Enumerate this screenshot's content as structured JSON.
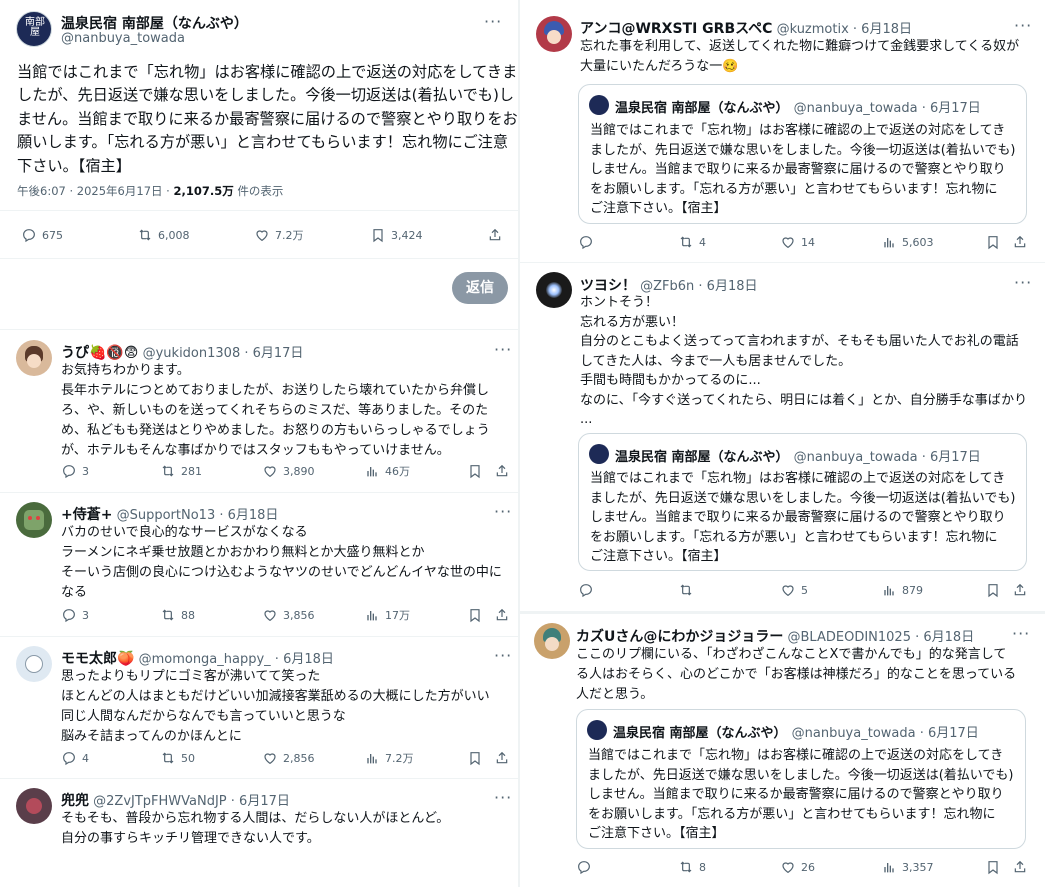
{
  "main_tweet": {
    "name": "温泉民宿 南部屋（なんぶや）",
    "handle": "@nanbuya_towada",
    "lines": [
      "当館ではこれまで「忘れ物」はお客様に確認の上で返送の対応をしてきま",
      "したが、先日返送で嫌な思いをしました。今後一切返送は(着払いでも)し",
      "ません。当館まで取りに来るか最寄警察に届けるので警察とやり取りをお",
      "願いします。「忘れる方が悪い」と言わせてもらいます！忘れ物にご注意",
      "下さい。【宿主】"
    ],
    "meta_time": "午後6:07 · 2025年6月17日 · ",
    "meta_views": "2,107.5万",
    "meta_suffix": " 件の表示",
    "replies": "675",
    "reposts": "6,008",
    "likes": "7.2万",
    "bookmarks": "3,424",
    "reply_button": "返信"
  },
  "quote_text_lines": [
    "当館ではこれまで「忘れ物」はお客様に確認の上で返送の対応をしてき",
    "ましたが、先日返送で嫌な思いをしました。今後一切返送は(着払いでも)",
    "しません。当館まで取りに来るか最寄警察に届けるので警察とやり取り",
    "をお願いします。「忘れる方が悪い」と言わせてもらいます！忘れ物に",
    "ご注意下さい。【宿主】"
  ],
  "quote_name": "温泉民宿 南部屋（なんぶや）",
  "quote_handle_date": "@nanbuya_towada · 6月17日",
  "left_replies": [
    {
      "name": "うぴ🍓🔞😨",
      "meta": "@yukidon1308 · 6月17日",
      "lines": [
        "お気持ちわかります。",
        "長年ホテルにつとめておりましたが、お送りしたら壊れていたから弁償し",
        "ろ、や、新しいものを送ってくれそちらのミスだ、等ありました。そのた",
        "め、私どもも発送はとりやめました。お怒りの方もいらっしゃるでしょう",
        "が、ホテルもそんな事ばかりではスタッフももやっていけません。"
      ],
      "replies": "3",
      "reposts": "281",
      "likes": "3,890",
      "views": "46万",
      "avatar_color": "#d9b99b"
    },
    {
      "name": "+侍蒼+",
      "meta": "@SupportNo13 · 6月18日",
      "lines": [
        "バカのせいで良心的なサービスがなくなる",
        "ラーメンにネギ乗せ放題とかおかわり無料とか大盛り無料とか",
        "そーいう店側の良心につけ込むようなヤツのせいでどんどんイヤな世の中に",
        "なる"
      ],
      "replies": "3",
      "reposts": "88",
      "likes": "3,856",
      "views": "17万",
      "avatar_color": "#4a6b3d"
    },
    {
      "name": "モモ太郎🍑",
      "meta": "@momonga_happy_ · 6月18日",
      "lines": [
        "思ったよりもリプにゴミ客が沸いてて笑った",
        "ほとんどの人はまともだけどいい加減接客業舐めるの大概にした方がいい",
        "同じ人間なんだからなんでも言っていいと思うな",
        "脳みそ詰まってんのかほんとに"
      ],
      "replies": "4",
      "reposts": "50",
      "likes": "2,856",
      "views": "7.2万",
      "avatar_color": "#dfe9f2"
    },
    {
      "name": "兜兜",
      "meta": "@2ZvJTpFHWVaNdJP · 6月17日",
      "lines": [
        "そもそも、普段から忘れ物する人間は、だらしない人がほとんど。",
        "自分の事すらキッチリ管理できない人です。"
      ],
      "avatar_color": "#5a3e4a"
    }
  ],
  "right_replies": [
    {
      "name": "アンコ@WRXSTI GRBスペC",
      "meta": "@kuzmotix · 6月18日",
      "lines": [
        "忘れた事を利用して、返送してくれた物に難癖つけて金銭要求してくる奴が",
        "大量にいたんだろうな一🥴"
      ],
      "replies": "",
      "reposts": "4",
      "likes": "14",
      "views": "5,603",
      "avatar_color": "#b23a48"
    },
    {
      "name": "ツヨシ！",
      "meta": "@ZFb6n · 6月18日",
      "lines": [
        "ホントそう！",
        "忘れる方が悪い！",
        "自分のとこもよく送ってって言われますが、そもそも届いた人でお礼の電話",
        "してきた人は、今まで一人も居ませんでした。",
        "手間も時間もかかってるのに...",
        "なのに、「今すぐ送ってくれたら、明日には着く」とか、自分勝手な事ばかり",
        "..."
      ],
      "replies": "",
      "reposts": "",
      "likes": "5",
      "views": "879",
      "avatar_color": "#1a1a1a"
    },
    {
      "name": "カズUさん@にわかジョジョラー",
      "meta": "@BLADEODIN1025 · 6月18日",
      "lines": [
        "ここのリプ欄にいる、「わざわざこんなことXで書かんでも」的な発言して",
        "る人はおそらく、心のどこかで「お客様は神様だろ」的なことを思っている",
        "人だと思う。"
      ],
      "replies": "",
      "reposts": "8",
      "likes": "26",
      "views": "3,357",
      "avatar_color": "#c9a16b"
    }
  ],
  "colors": {
    "text": "#0f1419",
    "muted": "#536471",
    "border": "#cfd9de",
    "button": "#8b98a5"
  },
  "icons": [
    "reply-icon",
    "repost-icon",
    "like-icon",
    "views-icon",
    "bookmark-icon",
    "share-icon",
    "more-icon"
  ]
}
